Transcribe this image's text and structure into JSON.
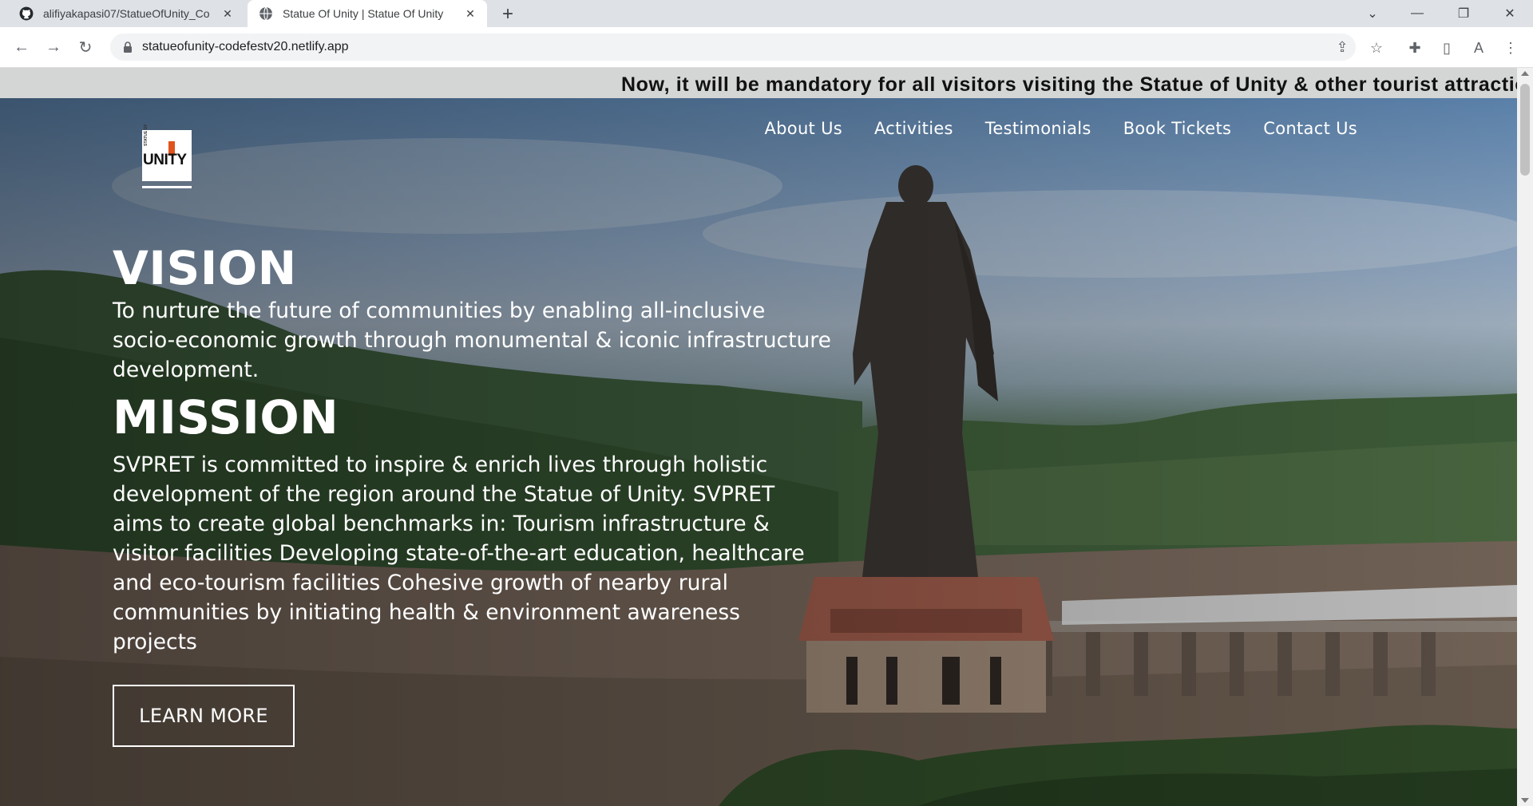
{
  "browser": {
    "tabs": [
      {
        "title": "alifiyakapasi07/StatueOfUnity_Co",
        "active": false,
        "icon": "github-icon"
      },
      {
        "title": "Statue Of Unity | Statue Of Unity",
        "active": true,
        "icon": "globe-icon"
      }
    ],
    "new_tab_symbol": "+",
    "address": {
      "url": "statueofunity-codefestv20.netlify.app"
    }
  },
  "page": {
    "announcement": "Now, it will be mandatory for all visitors visiting the Statue of Unity & other tourist attractions",
    "logo": {
      "small_text": "STATUE OF",
      "word": "UNITY",
      "accent_color": "#e0531c"
    },
    "nav": [
      {
        "label": "About Us"
      },
      {
        "label": "Activities"
      },
      {
        "label": "Testimonials"
      },
      {
        "label": "Book Tickets"
      },
      {
        "label": "Contact Us"
      }
    ],
    "vision": {
      "heading": "VISION",
      "text": "To nurture the future of communities by enabling all-inclusive socio-economic growth through monumental & iconic infrastructure development."
    },
    "mission": {
      "heading": "MISSION",
      "text": "SVPRET is committed to inspire & enrich lives through holistic development of the region around the Statue of Unity. SVPRET aims to create global benchmarks in: Tourism infrastructure & visitor facilities Developing state-of-the-art education, healthcare and eco-tourism facilities Cohesive growth of nearby rural communities by initiating health & environment awareness projects"
    },
    "cta": {
      "label": "LEARN MORE"
    }
  },
  "colors": {
    "tabstrip": "#dee1e6",
    "announcement_bar": "#d4d6d5",
    "hero_text": "#ffffff"
  }
}
